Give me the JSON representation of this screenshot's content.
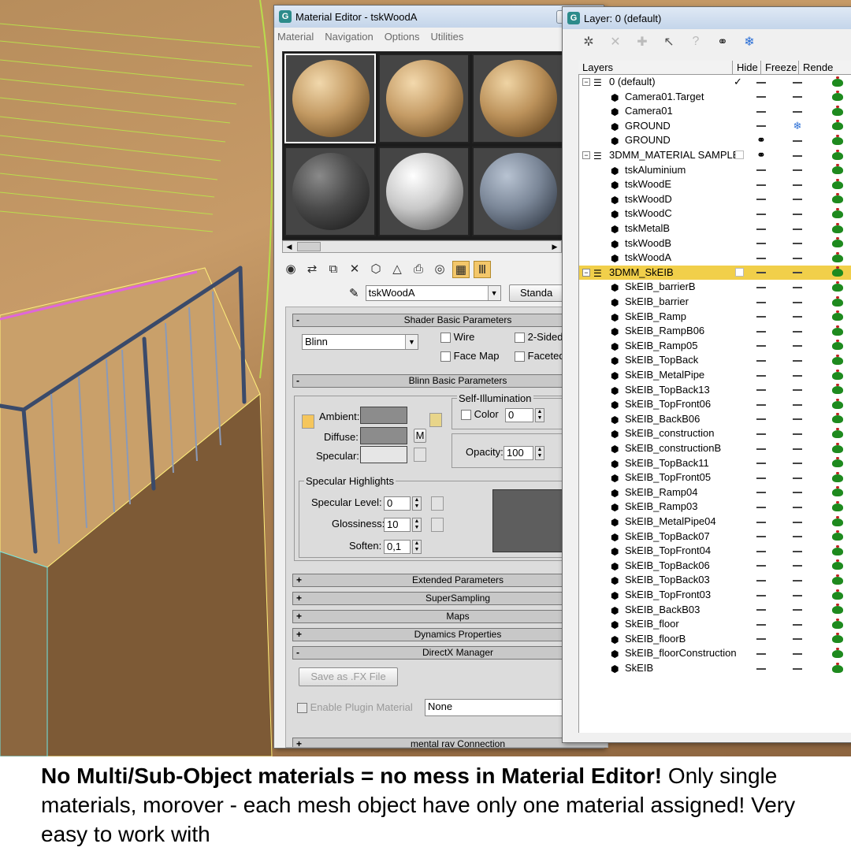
{
  "material_editor": {
    "title": "Material Editor - tskWoodA",
    "menu": [
      "Material",
      "Navigation",
      "Options",
      "Utilities"
    ],
    "material_name": "tskWoodA",
    "type_button": "Standa",
    "shader_rollout": "Shader Basic Parameters",
    "shader": "Blinn",
    "wire_label": "Wire",
    "two_sided_label": "2-Sided",
    "face_map_label": "Face Map",
    "faceted_label": "Faceted",
    "blinn_rollout": "Blinn Basic Parameters",
    "self_illum_label": "Self-Illumination",
    "color_label": "Color",
    "color_value": "0",
    "ambient_label": "Ambient:",
    "diffuse_label": "Diffuse:",
    "specular_label": "Specular:",
    "m_label": "M",
    "opacity_label": "Opacity:",
    "opacity_value": "100",
    "spec_highlights_label": "Specular Highlights",
    "spec_level_label": "Specular Level:",
    "spec_level_value": "0",
    "glossiness_label": "Glossiness:",
    "glossiness_value": "10",
    "soften_label": "Soften:",
    "soften_value": "0,1",
    "rollouts": [
      "Extended Parameters",
      "SuperSampling",
      "Maps",
      "Dynamics Properties"
    ],
    "directx_rollout": "DirectX Manager",
    "save_fx_label": "Save as .FX File",
    "enable_plugin_label": "Enable Plugin Material",
    "plugin_value": "None",
    "mental_ray_rollout": "mental ray Connection"
  },
  "layer_manager": {
    "title": "Layer: 0 (default)",
    "columns": [
      "Layers",
      "Hide",
      "Freeze",
      "Rende"
    ],
    "rows": [
      {
        "name": "0 (default)",
        "type": "layer",
        "hide": "dash",
        "freeze": "dash"
      },
      {
        "name": "Camera01.Target",
        "type": "object",
        "hide": "dash",
        "freeze": "dash"
      },
      {
        "name": "Camera01",
        "type": "object",
        "hide": "dash",
        "freeze": "dash"
      },
      {
        "name": "GROUND",
        "type": "object",
        "hide": "dash",
        "freeze": "snowflake"
      },
      {
        "name": "GROUND",
        "type": "object",
        "hide": "glasses",
        "freeze": "dash"
      },
      {
        "name": "3DMM_MATERIAL SAMPLE",
        "type": "layer",
        "hide": "glasses",
        "freeze": "dash"
      },
      {
        "name": "tskAluminium",
        "type": "object",
        "hide": "dash",
        "freeze": "dash"
      },
      {
        "name": "tskWoodE",
        "type": "object",
        "hide": "dash",
        "freeze": "dash"
      },
      {
        "name": "tskWoodD",
        "type": "object",
        "hide": "dash",
        "freeze": "dash"
      },
      {
        "name": "tskWoodC",
        "type": "object",
        "hide": "dash",
        "freeze": "dash"
      },
      {
        "name": "tskMetalB",
        "type": "object",
        "hide": "dash",
        "freeze": "dash"
      },
      {
        "name": "tskWoodB",
        "type": "object",
        "hide": "dash",
        "freeze": "dash"
      },
      {
        "name": "tskWoodA",
        "type": "object",
        "hide": "dash",
        "freeze": "dash"
      },
      {
        "name": "3DMM_SkEIB",
        "type": "layer",
        "hide": "dash",
        "freeze": "dash"
      },
      {
        "name": "SkEIB_barrierB",
        "type": "object",
        "hide": "dash",
        "freeze": "dash"
      },
      {
        "name": "SkEIB_barrier",
        "type": "object",
        "hide": "dash",
        "freeze": "dash"
      },
      {
        "name": "SkEIB_Ramp",
        "type": "object",
        "hide": "dash",
        "freeze": "dash"
      },
      {
        "name": "SkEIB_RampB06",
        "type": "object",
        "hide": "dash",
        "freeze": "dash"
      },
      {
        "name": "SkEIB_Ramp05",
        "type": "object",
        "hide": "dash",
        "freeze": "dash"
      },
      {
        "name": "SkEIB_TopBack",
        "type": "object",
        "hide": "dash",
        "freeze": "dash"
      },
      {
        "name": "SkEIB_MetalPipe",
        "type": "object",
        "hide": "dash",
        "freeze": "dash"
      },
      {
        "name": "SkEIB_TopBack13",
        "type": "object",
        "hide": "dash",
        "freeze": "dash"
      },
      {
        "name": "SkEIB_TopFront06",
        "type": "object",
        "hide": "dash",
        "freeze": "dash"
      },
      {
        "name": "SkEIB_BackB06",
        "type": "object",
        "hide": "dash",
        "freeze": "dash"
      },
      {
        "name": "SkEIB_construction",
        "type": "object",
        "hide": "dash",
        "freeze": "dash"
      },
      {
        "name": "SkEIB_constructionB",
        "type": "object",
        "hide": "dash",
        "freeze": "dash"
      },
      {
        "name": "SkEIB_TopBack11",
        "type": "object",
        "hide": "dash",
        "freeze": "dash"
      },
      {
        "name": "SkEIB_TopFront05",
        "type": "object",
        "hide": "dash",
        "freeze": "dash"
      },
      {
        "name": "SkEIB_Ramp04",
        "type": "object",
        "hide": "dash",
        "freeze": "dash"
      },
      {
        "name": "SkEIB_Ramp03",
        "type": "object",
        "hide": "dash",
        "freeze": "dash"
      },
      {
        "name": "SkEIB_MetalPipe04",
        "type": "object",
        "hide": "dash",
        "freeze": "dash"
      },
      {
        "name": "SkEIB_TopBack07",
        "type": "object",
        "hide": "dash",
        "freeze": "dash"
      },
      {
        "name": "SkEIB_TopFront04",
        "type": "object",
        "hide": "dash",
        "freeze": "dash"
      },
      {
        "name": "SkEIB_TopBack06",
        "type": "object",
        "hide": "dash",
        "freeze": "dash"
      },
      {
        "name": "SkEIB_TopBack03",
        "type": "object",
        "hide": "dash",
        "freeze": "dash"
      },
      {
        "name": "SkEIB_TopFront03",
        "type": "object",
        "hide": "dash",
        "freeze": "dash"
      },
      {
        "name": "SkEIB_BackB03",
        "type": "object",
        "hide": "dash",
        "freeze": "dash"
      },
      {
        "name": "SkEIB_floor",
        "type": "object",
        "hide": "dash",
        "freeze": "dash"
      },
      {
        "name": "SkEIB_floorB",
        "type": "object",
        "hide": "dash",
        "freeze": "dash"
      },
      {
        "name": "SkEIB_floorConstruction",
        "type": "object",
        "hide": "dash",
        "freeze": "dash"
      },
      {
        "name": "SkEIB",
        "type": "object",
        "hide": "dash",
        "freeze": "dash"
      }
    ]
  },
  "caption": {
    "bold": "No Multi/Sub-Object materials = no mess in Material Editor!",
    "normal": " Only single materials, morover - each mesh object have only one material assigned! Very easy to work with"
  }
}
